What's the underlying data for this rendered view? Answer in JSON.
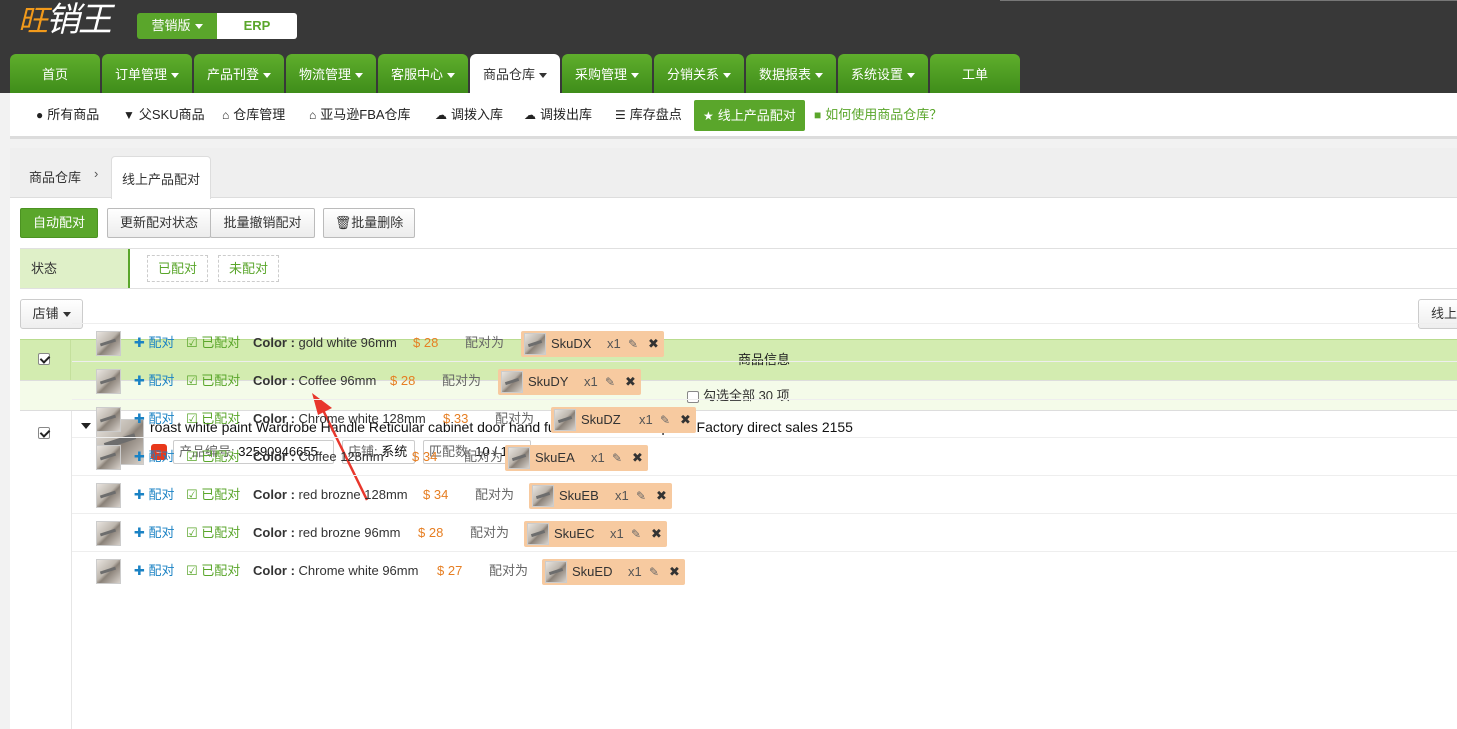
{
  "brand": {
    "logo_text": "旺销王",
    "edition": "营销版",
    "product": "ERP"
  },
  "nav": {
    "tabs": [
      {
        "label": "首页",
        "dropdown": false
      },
      {
        "label": "订单管理",
        "dropdown": true
      },
      {
        "label": "产品刊登",
        "dropdown": true
      },
      {
        "label": "物流管理",
        "dropdown": true
      },
      {
        "label": "客服中心",
        "dropdown": true
      },
      {
        "label": "商品仓库",
        "dropdown": true,
        "active": true
      },
      {
        "label": "采购管理",
        "dropdown": true
      },
      {
        "label": "分销关系",
        "dropdown": true
      },
      {
        "label": "数据报表",
        "dropdown": true
      },
      {
        "label": "系统设置",
        "dropdown": true
      },
      {
        "label": "工单",
        "dropdown": false
      }
    ]
  },
  "subnav": {
    "items": [
      {
        "icon": "circle-icon",
        "label": "所有商品"
      },
      {
        "icon": "filter-icon",
        "label": "父SKU商品"
      },
      {
        "icon": "home-icon",
        "label": "仓库管理"
      },
      {
        "icon": "home-icon",
        "label": "亚马逊FBA仓库"
      },
      {
        "icon": "cloud-upload-icon",
        "label": "调拨入库"
      },
      {
        "icon": "cloud-download-icon",
        "label": "调拨出库"
      },
      {
        "icon": "list-icon",
        "label": "库存盘点"
      },
      {
        "icon": "star-icon",
        "label": "线上产品配对",
        "active": true
      },
      {
        "icon": "video-icon",
        "label": "如何使用商品仓库？"
      }
    ]
  },
  "breadcrumb": {
    "parent": "商品仓库",
    "current": "线上产品配对"
  },
  "toolbar": {
    "auto_pair": "自动配对",
    "update_status": "更新配对状态",
    "batch_unpair": "批量撤销配对",
    "batch_delete": "批量删除"
  },
  "status_filter": {
    "label": "状态",
    "options": [
      "已配对",
      "未配对"
    ]
  },
  "shop_dropdown": "店铺",
  "right_button": "线上",
  "table": {
    "header": "商品信息",
    "select_all": "勾选全部 30 项"
  },
  "product": {
    "title": "roast white paint Wardrobe Handle Reticular cabinet door hand furniture hardware parts Factory direct sales 2155",
    "platform_icon": "aliexpress-icon",
    "id_label": "产品编号:",
    "id_value": "32590946655",
    "shop_label": "店铺:",
    "shop_value": "系统",
    "match_label": "匹配数:",
    "match_value": "10 / 10",
    "variants": [
      {
        "pair": "配对",
        "status": "已配对",
        "attr": "Color",
        "value": "gold white 96mm",
        "price": "$ 28",
        "pair_to": "配对为",
        "sku": "SkuDX",
        "qty": "x1"
      },
      {
        "pair": "配对",
        "status": "已配对",
        "attr": "Color",
        "value": "Coffee 96mm",
        "price": "$ 28",
        "pair_to": "配对为",
        "sku": "SkuDY",
        "qty": "x1"
      },
      {
        "pair": "配对",
        "status": "已配对",
        "attr": "Color",
        "value": "Chrome white 128mm",
        "price": "$ 33",
        "pair_to": "配对为",
        "sku": "SkuDZ",
        "qty": "x1"
      },
      {
        "pair": "配对",
        "status": "已配对",
        "attr": "Color",
        "value": "Coffee 128mm",
        "price": "$ 34",
        "pair_to": "配对为",
        "sku": "SkuEA",
        "qty": "x1"
      },
      {
        "pair": "配对",
        "status": "已配对",
        "attr": "Color",
        "value": "red brozne 128mm",
        "price": "$ 34",
        "pair_to": "配对为",
        "sku": "SkuEB",
        "qty": "x1"
      },
      {
        "pair": "配对",
        "status": "已配对",
        "attr": "Color",
        "value": "red brozne 96mm",
        "price": "$ 28",
        "pair_to": "配对为",
        "sku": "SkuEC",
        "qty": "x1"
      },
      {
        "pair": "配对",
        "status": "已配对",
        "attr": "Color",
        "value": "Chrome white 96mm",
        "price": "$ 27",
        "pair_to": "配对为",
        "sku": "SkuED",
        "qty": "x1"
      }
    ]
  },
  "colors": {
    "brand_green": "#5aa62b",
    "topbar": "#383838",
    "price_orange": "#e67e22",
    "sku_bg": "#f7caa0",
    "annotation_red": "#e8372c"
  }
}
